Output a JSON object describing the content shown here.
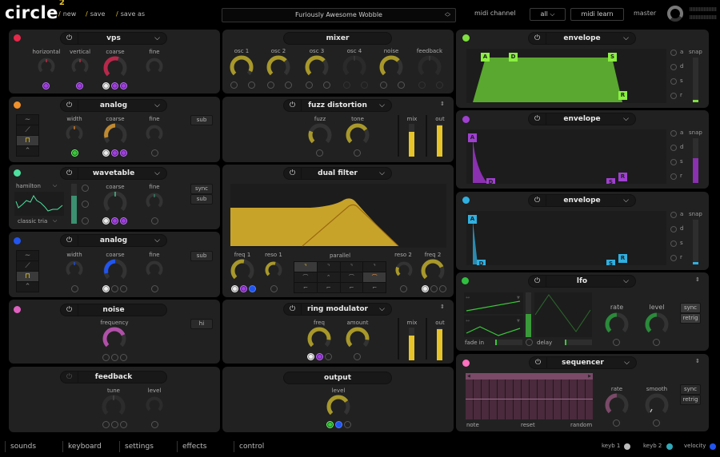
{
  "app": {
    "name": "circle",
    "superscript": "2"
  },
  "toplinks": [
    "new",
    "save",
    "save as"
  ],
  "preset": {
    "name": "Furiously Awesome Wobble"
  },
  "midi": {
    "channel_label": "midi channel",
    "channel_value": "all",
    "learn_label": "midi learn"
  },
  "master": {
    "label": "master",
    "level": 0.8
  },
  "colors": {
    "accent": "#e6c42a",
    "osc1": "#e8284a",
    "osc2": "#f0902a",
    "osc3": "#4ee0a0",
    "osc4": "#2255ee",
    "noise": "#e060c0",
    "env1": "#7fe040",
    "env2": "#a040d0",
    "env3": "#30b0e0",
    "lfo": "#30c040",
    "seq": "#ff70c0"
  },
  "osc1": {
    "type": "vps",
    "knobs": [
      "horizontal",
      "vertical",
      "coarse",
      "fine"
    ]
  },
  "osc2": {
    "type": "analog",
    "knobs": [
      "width",
      "coarse",
      "fine"
    ],
    "button": "sub"
  },
  "osc3": {
    "type": "wavetable",
    "table": "hamilton",
    "shape": "classic tria",
    "knobs": [
      "coarse",
      "fine"
    ],
    "buttons": [
      "sync",
      "sub"
    ]
  },
  "osc4": {
    "type": "analog",
    "knobs": [
      "width",
      "coarse",
      "fine"
    ],
    "button": "sub"
  },
  "noise": {
    "title": "noise",
    "knob": "frequency",
    "button": "hi"
  },
  "feedback": {
    "title": "feedback",
    "knobs": [
      "tune",
      "level"
    ]
  },
  "mixer": {
    "title": "mixer",
    "channels": [
      "osc 1",
      "osc 2",
      "osc 3",
      "osc 4",
      "noise",
      "feedback"
    ]
  },
  "fx1": {
    "type": "fuzz distortion",
    "knobs": [
      "fuzz",
      "tone"
    ],
    "meters": [
      "mix",
      "out"
    ],
    "mix_level": 0.75,
    "out_level": 0.95
  },
  "filter": {
    "type": "dual filter",
    "mode": "parallel",
    "knobs": [
      "freq 1",
      "reso 1",
      "reso 2",
      "freq 2"
    ]
  },
  "fx2": {
    "type": "ring modulator",
    "knobs": [
      "freq",
      "amount"
    ],
    "meters": [
      "mix",
      "out"
    ],
    "mix_level": 0.75,
    "out_level": 0.95
  },
  "output": {
    "title": "output",
    "knob": "level"
  },
  "env1": {
    "title": "envelope",
    "points": [
      "A",
      "D",
      "S",
      "R"
    ],
    "radios": [
      "a",
      "d",
      "s",
      "r"
    ],
    "snap": "snap"
  },
  "env2": {
    "title": "envelope",
    "points": [
      "A",
      "D",
      "S",
      "R"
    ],
    "radios": [
      "a",
      "d",
      "s",
      "r"
    ],
    "snap": "snap"
  },
  "env3": {
    "title": "envelope",
    "points": [
      "A",
      "D",
      "S",
      "R"
    ],
    "radios": [
      "a",
      "d",
      "s",
      "r"
    ],
    "snap": "snap"
  },
  "lfo": {
    "title": "lfo",
    "fade_in": "fade in",
    "delay": "delay",
    "knobs": [
      "rate",
      "level"
    ],
    "buttons": [
      "sync",
      "retrig"
    ]
  },
  "sequencer": {
    "title": "sequencer",
    "labels": [
      "note",
      "reset",
      "random"
    ],
    "knobs": [
      "rate",
      "smooth"
    ],
    "buttons": [
      "sync",
      "retrig"
    ]
  },
  "nav": [
    "sounds",
    "keyboard",
    "settings",
    "effects",
    "control"
  ],
  "legend": [
    "keyb 1",
    "keyb 2",
    "velocity"
  ]
}
